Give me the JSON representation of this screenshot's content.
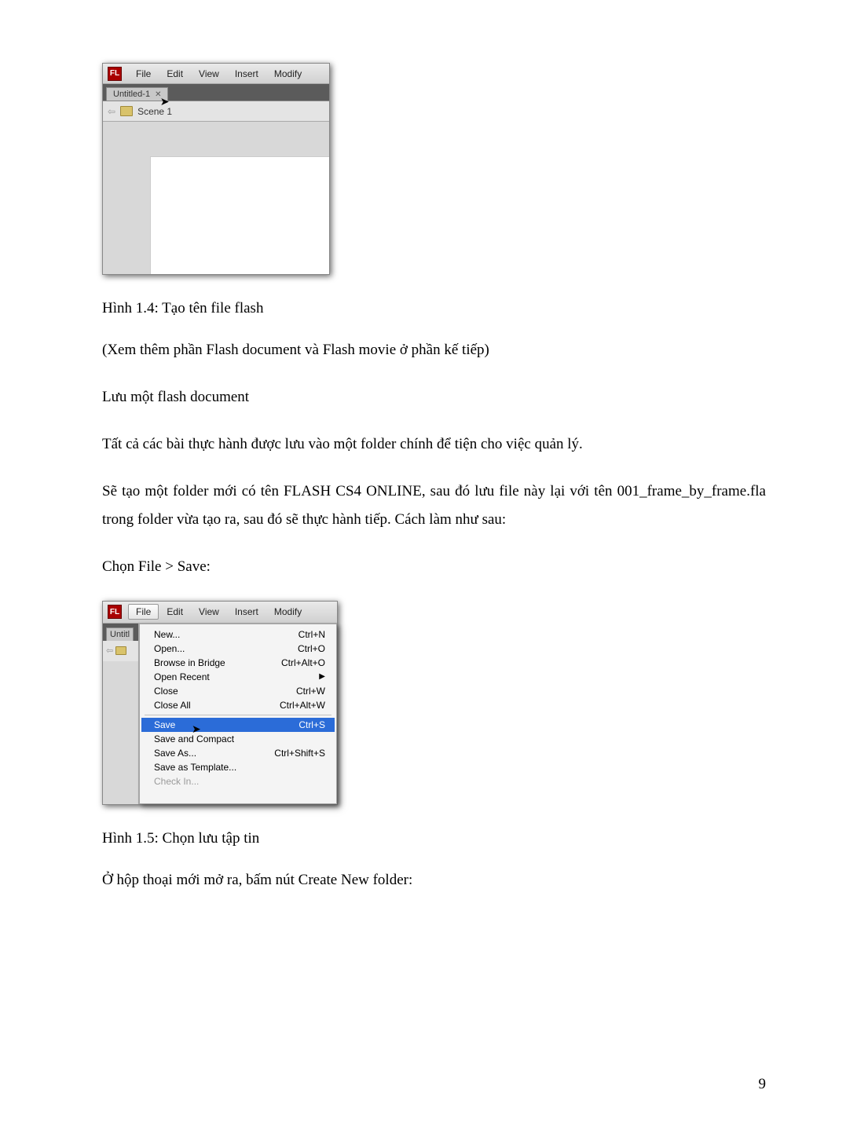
{
  "screenshot1": {
    "app_logo": "FL",
    "menu": [
      "File",
      "Edit",
      "View",
      "Insert",
      "Modify"
    ],
    "tab_label": "Untitled-1",
    "scene_label": "Scene 1"
  },
  "caption1": "Hình 1.4: Tạo tên file flash",
  "para1": "(Xem thêm phần Flash document và Flash movie ở phần kế tiếp)",
  "para2": "Lưu một flash document",
  "para3": "Tất cả các bài thực hành được lưu vào một folder chính để tiện cho việc quản lý.",
  "para4": "Sẽ tạo một folder mới có tên FLASH CS4 ONLINE, sau đó lưu file này lại với tên 001_frame_by_frame.fla trong folder vừa tạo ra, sau đó sẽ thực hành tiếp. Cách làm như sau:",
  "para5": "Chọn File > Save:",
  "screenshot2": {
    "app_logo": "FL",
    "menu": [
      "File",
      "Edit",
      "View",
      "Insert",
      "Modify"
    ],
    "highlighted_menu": "File",
    "left_tab": "Untitl",
    "items": [
      {
        "label": "New...",
        "shortcut": "Ctrl+N",
        "state": "normal"
      },
      {
        "label": "Open...",
        "shortcut": "Ctrl+O",
        "state": "normal"
      },
      {
        "label": "Browse in Bridge",
        "shortcut": "Ctrl+Alt+O",
        "state": "normal"
      },
      {
        "label": "Open Recent",
        "shortcut": "",
        "state": "submenu"
      },
      {
        "label": "Close",
        "shortcut": "Ctrl+W",
        "state": "normal"
      },
      {
        "label": "Close All",
        "shortcut": "Ctrl+Alt+W",
        "state": "normal"
      },
      {
        "sep": true
      },
      {
        "label": "Save",
        "shortcut": "Ctrl+S",
        "state": "highlight"
      },
      {
        "label": "Save and Compact",
        "shortcut": "",
        "state": "normal"
      },
      {
        "label": "Save As...",
        "shortcut": "Ctrl+Shift+S",
        "state": "normal"
      },
      {
        "label": "Save as Template...",
        "shortcut": "",
        "state": "normal"
      },
      {
        "label": "Check In...",
        "shortcut": "",
        "state": "disabled"
      }
    ]
  },
  "caption2": "Hình 1.5: Chọn lưu tập tin",
  "para6": "Ở hộp thoại mới mở ra, bấm nút Create New folder:",
  "page_number": "9"
}
